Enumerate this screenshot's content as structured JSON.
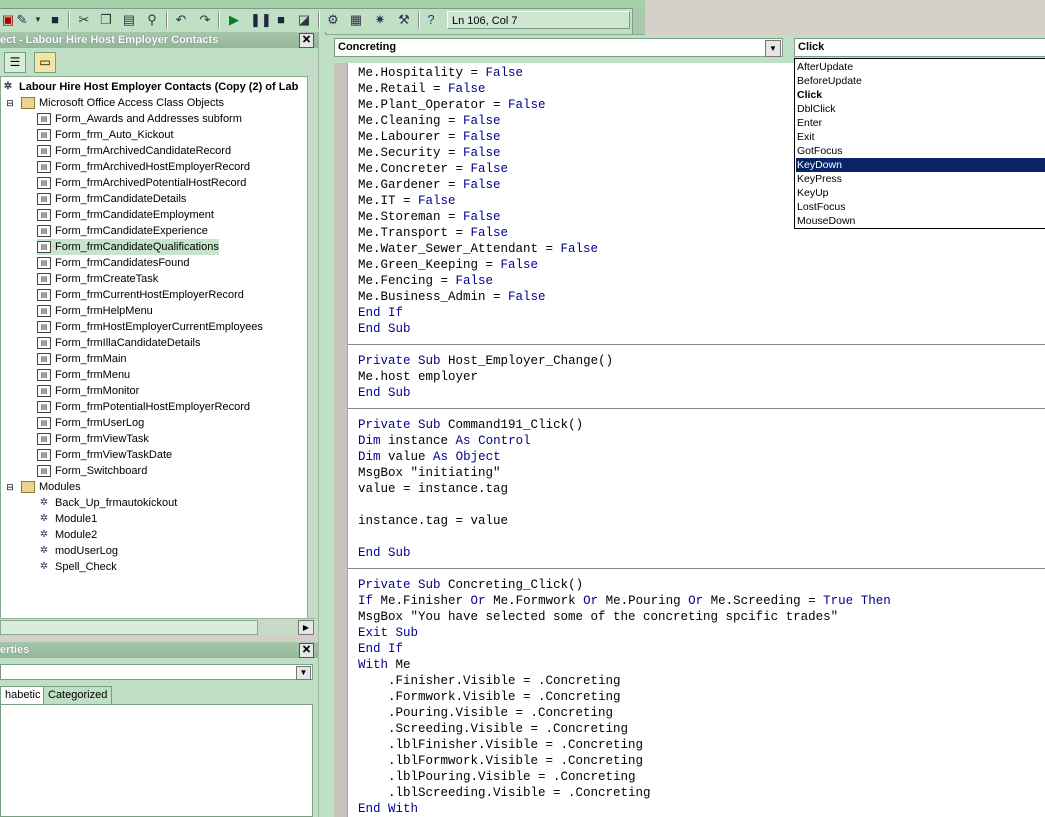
{
  "toolbar": {
    "cursor_position": "Ln 106, Col 7"
  },
  "project_panel": {
    "title": "ect - Labour Hire Host Employer Contacts",
    "root_label": "Labour Hire Host Employer Contacts (Copy (2) of Lab",
    "folders": {
      "class_objects": "Microsoft Office Access Class Objects",
      "modules": "Modules"
    },
    "forms": [
      "Form_Awards and Addresses subform",
      "Form_frm_Auto_Kickout",
      "Form_frmArchivedCandidateRecord",
      "Form_frmArchivedHostEmployerRecord",
      "Form_frmArchivedPotentialHostRecord",
      "Form_frmCandidateDetails",
      "Form_frmCandidateEmployment",
      "Form_frmCandidateExperience",
      "Form_frmCandidateQualifications",
      "Form_frmCandidatesFound",
      "Form_frmCreateTask",
      "Form_frmCurrentHostEmployerRecord",
      "Form_frmHelpMenu",
      "Form_frmHostEmployerCurrentEmployees",
      "Form_frmIllaCandidateDetails",
      "Form_frmMain",
      "Form_frmMenu",
      "Form_frmMonitor",
      "Form_frmPotentialHostEmployerRecord",
      "Form_frmUserLog",
      "Form_frmViewTask",
      "Form_frmViewTaskDate",
      "Form_Switchboard"
    ],
    "selected_form": "Form_frmCandidateQualifications",
    "modules": [
      "Back_Up_frmautokickout",
      "Module1",
      "Module2",
      "modUserLog",
      "Spell_Check"
    ]
  },
  "properties_panel": {
    "title": "erties",
    "tabs": [
      "habetic",
      "Categorized"
    ]
  },
  "code_window": {
    "object_combo": "Concreting",
    "procedure_combo": "Click",
    "procedure_list": [
      "AfterUpdate",
      "BeforeUpdate",
      "Click",
      "DblClick",
      "Enter",
      "Exit",
      "GotFocus",
      "KeyDown",
      "KeyPress",
      "KeyUp",
      "LostFocus",
      "MouseDown"
    ],
    "procedure_list_bold": "Click",
    "procedure_list_highlighted": "KeyDown",
    "lines": [
      "Me.Hospitality = False",
      "Me.Retail = False",
      "Me.Plant_Operator = False",
      "Me.Cleaning = False",
      "Me.Labourer = False",
      "Me.Security = False",
      "Me.Concreter = False",
      "Me.Gardener = False",
      "Me.IT = False",
      "Me.Storeman = False",
      "Me.Transport = False",
      "Me.Water_Sewer_Attendant = False",
      "Me.Green_Keeping = False",
      "Me.Fencing = False",
      "Me.Business_Admin = False",
      "End If",
      "End Sub",
      "",
      "Private Sub Host_Employer_Change()",
      "Me.host employer",
      "End Sub",
      "",
      "Private Sub Command191_Click()",
      "Dim instance As Control",
      "Dim value As Object",
      "MsgBox \"initiating\"",
      "value = instance.tag",
      "",
      "instance.tag = value",
      "",
      "End Sub",
      "",
      "Private Sub Concreting_Click()",
      "If Me.Finisher Or Me.Formwork Or Me.Pouring Or Me.Screeding = True Then",
      "MsgBox \"You have selected some of the concreting spcific trades\"",
      "Exit Sub",
      "End If",
      "With Me",
      "    .Finisher.Visible = .Concreting",
      "    .Formwork.Visible = .Concreting",
      "    .Pouring.Visible = .Concreting",
      "    .Screeding.Visible = .Concreting",
      "    .lblFinisher.Visible = .Concreting",
      "    .lblFormwork.Visible = .Concreting",
      "    .lblPouring.Visible = .Concreting",
      "    .lblScreeding.Visible = .Concreting",
      "End With"
    ],
    "procedure_separators_after_line": [
      16,
      20,
      30
    ]
  }
}
